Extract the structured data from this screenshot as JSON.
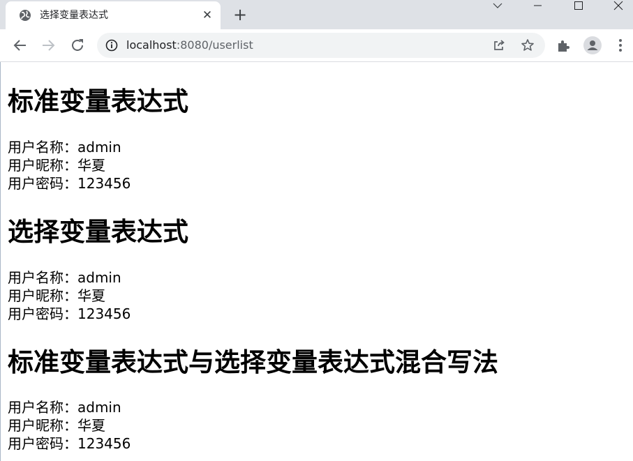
{
  "browser": {
    "tab_title": "选择变量表达式",
    "url_host": "localhost",
    "url_rest": ":8080/userlist",
    "accent": "#1a73e8"
  },
  "sections": [
    {
      "heading": "标准变量表达式",
      "lines": [
        "用户名称：admin",
        "用户昵称：华夏",
        "用户密码：123456"
      ]
    },
    {
      "heading": "选择变量表达式",
      "lines": [
        "用户名称：admin",
        "用户昵称：华夏",
        "用户密码：123456"
      ]
    },
    {
      "heading": "标准变量表达式与选择变量表达式混合写法",
      "lines": [
        "用户名称：admin",
        "用户昵称：华夏",
        "用户密码：123456"
      ]
    }
  ],
  "icons": {
    "favicon": "globe-icon",
    "tab_close": "close-icon",
    "new_tab": "plus-icon",
    "back": "arrow-left-icon",
    "forward": "arrow-right-icon",
    "reload": "reload-icon",
    "site_info": "info-icon",
    "share": "share-icon",
    "bookmark": "star-icon",
    "extensions": "puzzle-icon",
    "profile": "avatar-icon",
    "menu": "kebab-menu-icon"
  }
}
